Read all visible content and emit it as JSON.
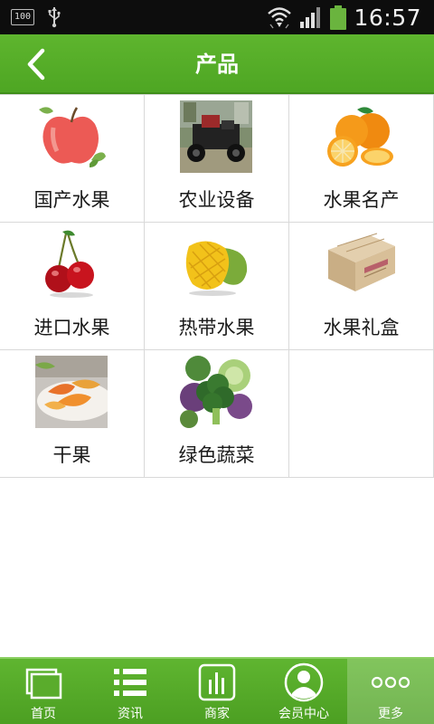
{
  "status_bar": {
    "battery_small": "100",
    "time": "16:57"
  },
  "header": {
    "title": "产品",
    "back_icon": "chevron-left-icon"
  },
  "products": [
    {
      "label": "国产水果",
      "image": "apple-photo"
    },
    {
      "label": "农业设备",
      "image": "farm-machine-photo"
    },
    {
      "label": "水果名产",
      "image": "orange-photo"
    },
    {
      "label": "进口水果",
      "image": "cherry-photo"
    },
    {
      "label": "热带水果",
      "image": "mango-photo"
    },
    {
      "label": "水果礼盒",
      "image": "gift-box-photo"
    },
    {
      "label": "干果",
      "image": "dried-fruit-photo"
    },
    {
      "label": "绿色蔬菜",
      "image": "vegetables-photo"
    }
  ],
  "tabbar": {
    "tabs": [
      {
        "label": "首页",
        "icon": "home-pages-icon"
      },
      {
        "label": "资讯",
        "icon": "list-icon"
      },
      {
        "label": "商家",
        "icon": "bar-chart-icon"
      },
      {
        "label": "会员中心",
        "icon": "user-icon"
      },
      {
        "label": "更多",
        "icon": "more-dots-icon"
      }
    ],
    "active_index": 4
  },
  "colors": {
    "brand_green": "#55ad28",
    "header_text": "#ffffff",
    "grid_line": "#d9d9d9"
  }
}
